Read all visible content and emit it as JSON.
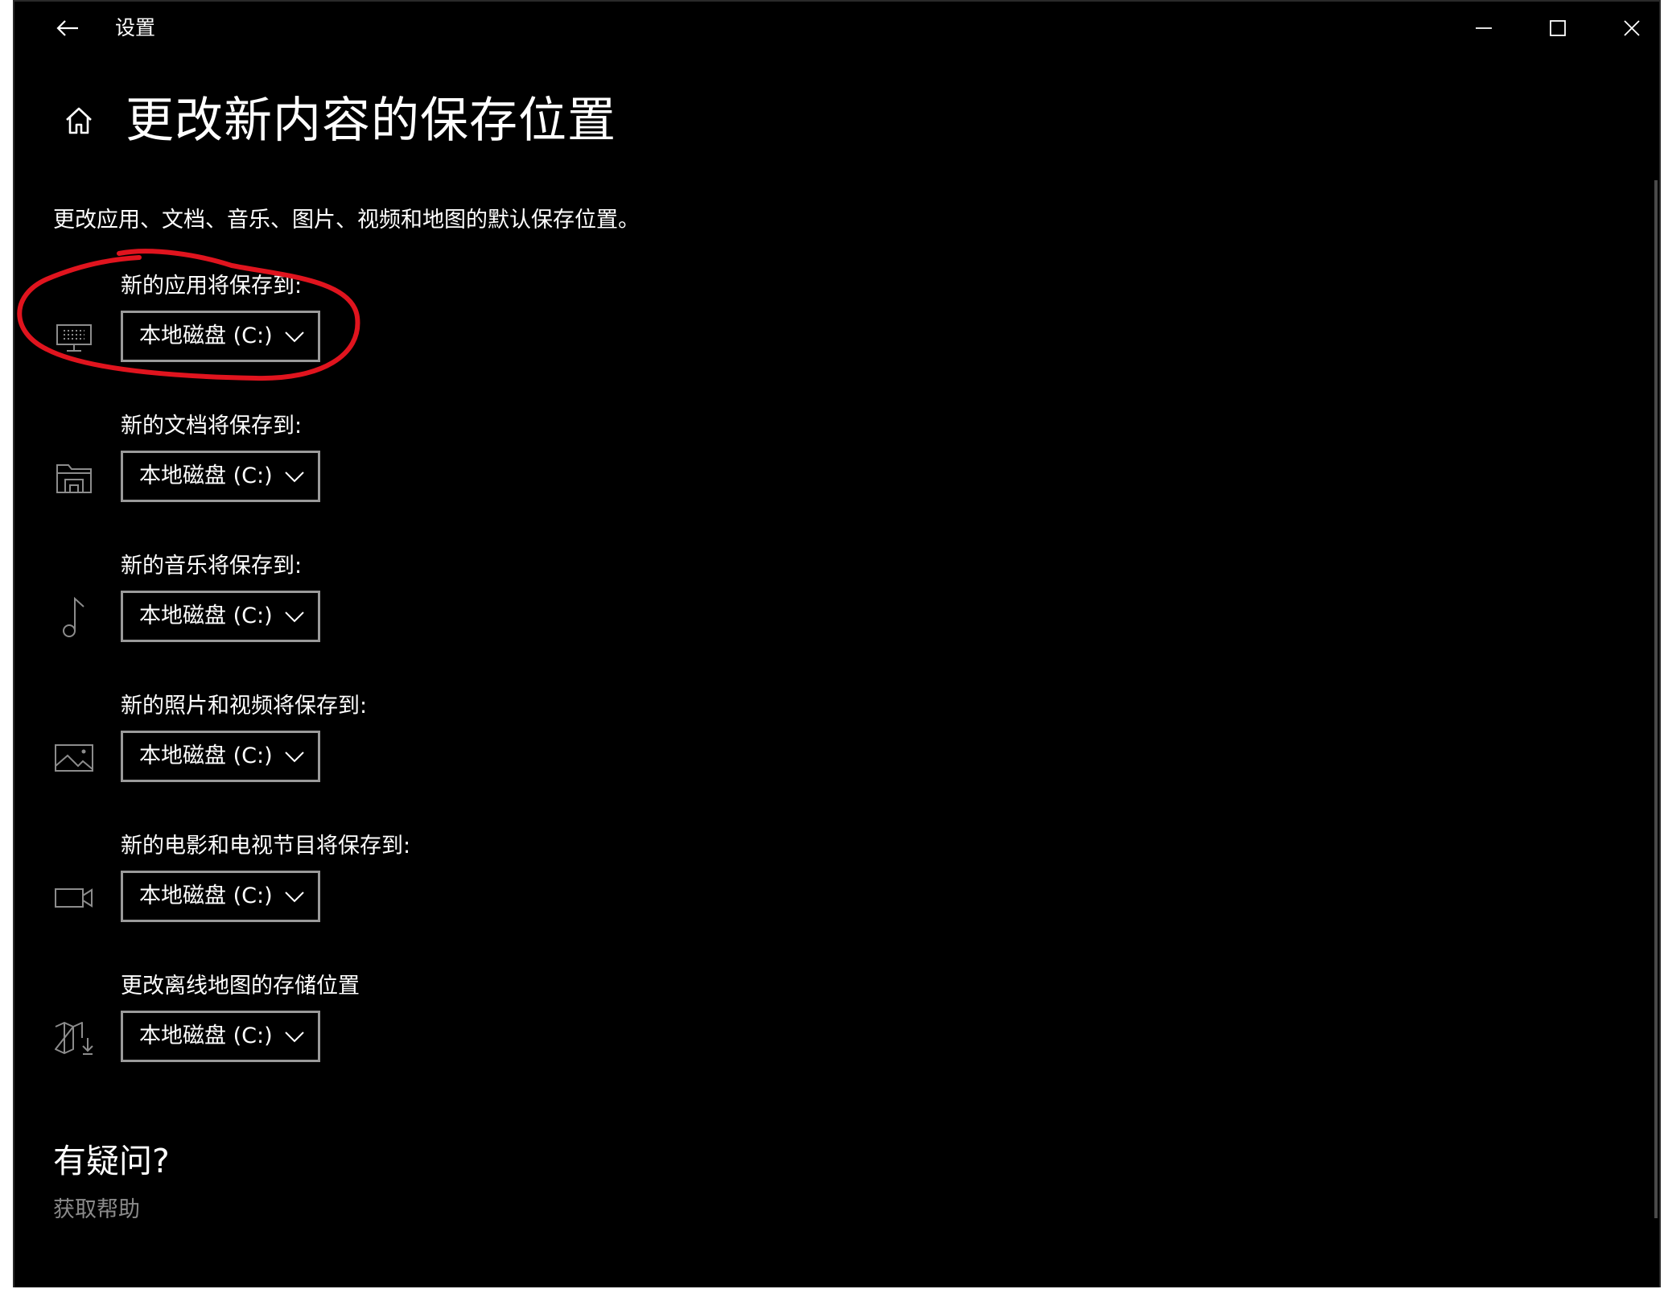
{
  "window": {
    "title": "设置"
  },
  "page": {
    "title": "更改新内容的保存位置",
    "description": "更改应用、文档、音乐、图片、视频和地图的默认保存位置。"
  },
  "settings": [
    {
      "label": "新的应用将保存到:",
      "value": "本地磁盘 (C:)",
      "icon": "monitor-icon"
    },
    {
      "label": "新的文档将保存到:",
      "value": "本地磁盘 (C:)",
      "icon": "documents-folder-icon"
    },
    {
      "label": "新的音乐将保存到:",
      "value": "本地磁盘 (C:)",
      "icon": "music-note-icon"
    },
    {
      "label": "新的照片和视频将保存到:",
      "value": "本地磁盘 (C:)",
      "icon": "picture-icon"
    },
    {
      "label": "新的电影和电视节目将保存到:",
      "value": "本地磁盘 (C:)",
      "icon": "video-camera-icon"
    },
    {
      "label": "更改离线地图的存储位置",
      "value": "本地磁盘 (C:)",
      "icon": "map-download-icon"
    }
  ],
  "help": {
    "title": "有疑问?",
    "link": "获取帮助"
  },
  "colors": {
    "background": "#000000",
    "text": "#ffffff",
    "muted_text": "#8a8a8a",
    "dropdown_border": "#9a9a9a",
    "icon": "#8c8c8c",
    "annotation": "#e0141e"
  }
}
